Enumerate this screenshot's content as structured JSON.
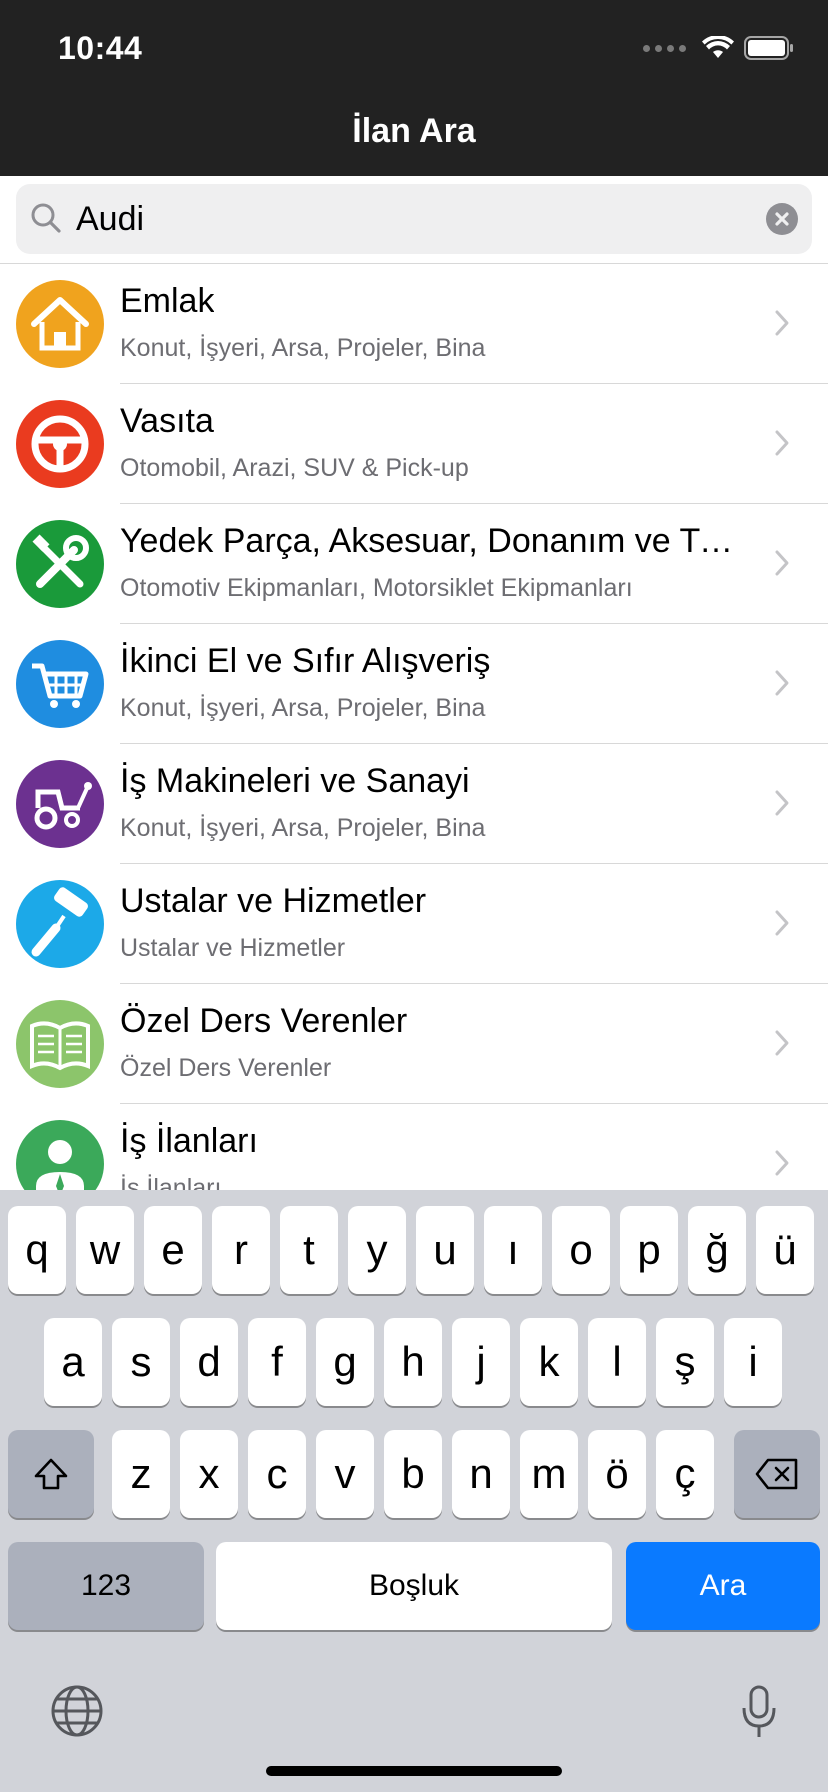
{
  "status": {
    "time": "10:44"
  },
  "nav": {
    "title": "İlan Ara"
  },
  "search": {
    "value": "Audi"
  },
  "categories": [
    {
      "title": "Emlak",
      "subtitle": "Konut, İşyeri, Arsa, Projeler, Bina",
      "icon": "house-icon",
      "color": "#f0a31e"
    },
    {
      "title": "Vasıta",
      "subtitle": "Otomobil, Arazi, SUV & Pick-up",
      "icon": "steering-wheel-icon",
      "color": "#ea3b1f"
    },
    {
      "title": "Yedek Parça, Aksesuar, Donanım ve Tu...",
      "subtitle": "Otomotiv Ekipmanları, Motorsiklet Ekipmanları",
      "icon": "tools-icon",
      "color": "#1a9a3a"
    },
    {
      "title": "İkinci El ve Sıfır Alışveriş",
      "subtitle": "Konut, İşyeri, Arsa, Projeler, Bina",
      "icon": "cart-icon",
      "color": "#1f8de0"
    },
    {
      "title": "İş Makineleri ve Sanayi",
      "subtitle": "Konut, İşyeri, Arsa, Projeler, Bina",
      "icon": "tractor-icon",
      "color": "#6c3190"
    },
    {
      "title": "Ustalar ve Hizmetler",
      "subtitle": "Ustalar ve Hizmetler",
      "icon": "paint-roller-icon",
      "color": "#1ca9e8"
    },
    {
      "title": "Özel Ders Verenler",
      "subtitle": "Özel Ders Verenler",
      "icon": "book-icon",
      "color": "#8cc56b"
    },
    {
      "title": "İş İlanları",
      "subtitle": "İş İlanları",
      "icon": "person-icon",
      "color": "#3ba95a"
    }
  ],
  "keyboard": {
    "row1": [
      "q",
      "w",
      "e",
      "r",
      "t",
      "y",
      "u",
      "ı",
      "o",
      "p",
      "ğ",
      "ü"
    ],
    "row2": [
      "a",
      "s",
      "d",
      "f",
      "g",
      "h",
      "j",
      "k",
      "l",
      "ş",
      "i"
    ],
    "row3": [
      "z",
      "x",
      "c",
      "v",
      "b",
      "n",
      "m",
      "ö",
      "ç"
    ],
    "numbers_label": "123",
    "space_label": "Boşluk",
    "search_label": "Ara"
  }
}
